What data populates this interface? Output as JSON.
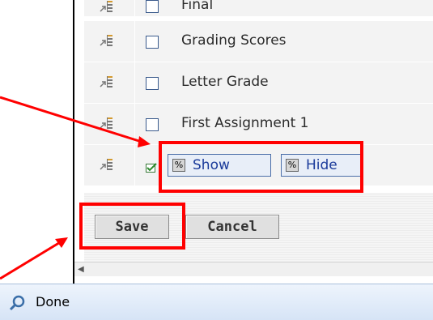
{
  "rows": [
    {
      "label": "Final",
      "checked": false
    },
    {
      "label": "Grading Scores",
      "checked": false
    },
    {
      "label": "Letter Grade",
      "checked": false
    },
    {
      "label": "First Assignment 1",
      "checked": false
    },
    {
      "label": "",
      "checked": true
    }
  ],
  "visibility_buttons": {
    "show_label": "Show",
    "hide_label": "Hide"
  },
  "form_buttons": {
    "save_label": "Save",
    "cancel_label": "Cancel"
  },
  "status_bar": {
    "text": "Done"
  },
  "colors": {
    "highlight": "#ff0000",
    "status_bg": "#dbe8f8",
    "link_blue": "#1a3a9a"
  }
}
